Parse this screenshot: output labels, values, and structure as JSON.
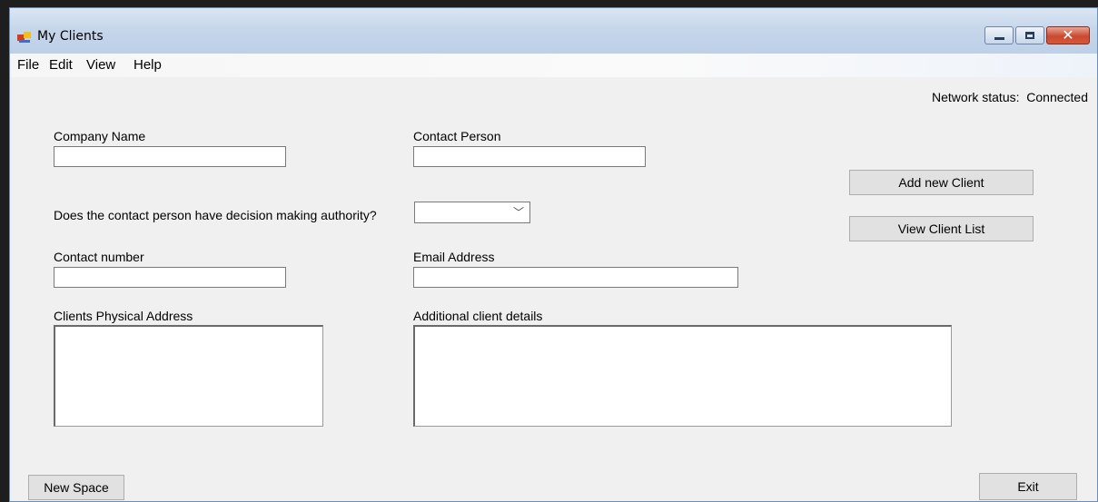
{
  "window": {
    "title": "My Clients",
    "accent": "#c94a30"
  },
  "menu": {
    "file": "File",
    "edit": "Edit",
    "view": "View",
    "help": "Help"
  },
  "status": {
    "label": "Network status:",
    "value": "Connected"
  },
  "form": {
    "company_name": {
      "label": "Company Name",
      "value": ""
    },
    "contact_person": {
      "label": "Contact Person",
      "value": ""
    },
    "decision_authority": {
      "label": "Does the contact person have decision making authority?",
      "value": ""
    },
    "contact_number": {
      "label": "Contact number",
      "value": ""
    },
    "email": {
      "label": "Email Address",
      "value": ""
    },
    "physical_address": {
      "label": "Clients Physical Address",
      "value": ""
    },
    "additional_details": {
      "label": "Additional client details",
      "value": ""
    }
  },
  "buttons": {
    "add_client": "Add new Client",
    "view_list": "View Client List",
    "new_space": "New Space",
    "exit": "Exit"
  },
  "icons": {
    "app": "app-windows-icon",
    "minimize": "minimize-icon",
    "maximize": "maximize-icon",
    "close": "close-icon",
    "dropdown": "chevron-down-icon"
  }
}
